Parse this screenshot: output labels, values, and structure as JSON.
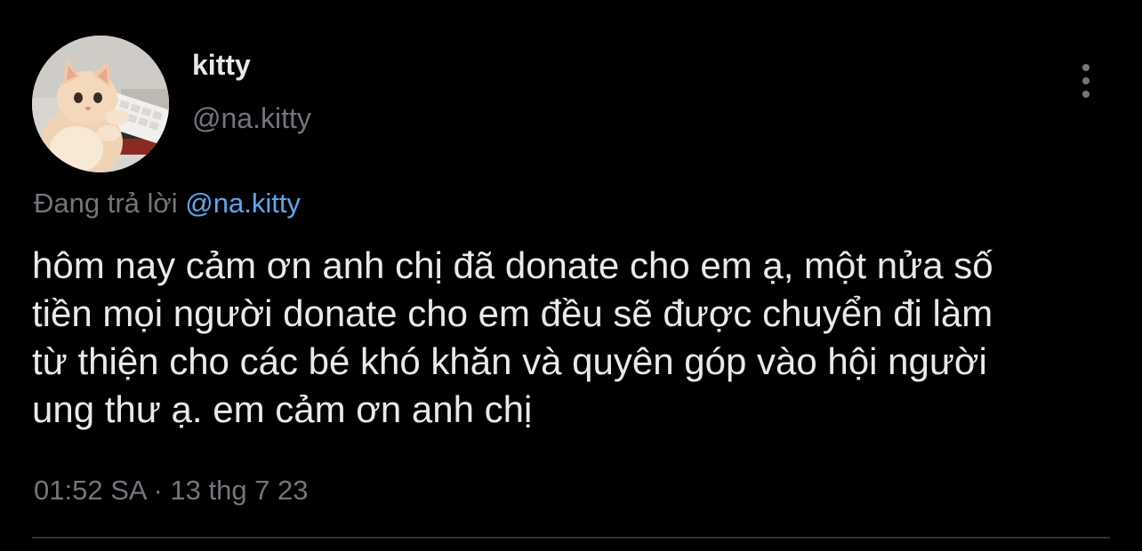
{
  "tweet": {
    "author_name": "kitty",
    "author_handle": "@na.kitty",
    "reply_prefix": "Đang trả lời",
    "reply_to_handle": "@na.kitty",
    "text_lines": [
      "hôm nay cảm ơn anh chị đã donate cho em ạ, một nửa số",
      "tiền mọi người donate cho em đều sẽ được chuyển đi làm",
      "từ thiện cho các bé khó khăn và quyên góp vào hội người",
      "ung thư ạ. em cảm ơn anh chị"
    ],
    "timestamp": "01:52 SA · 13 thg 7 23",
    "avatar_icon": "cat-avatar",
    "more_icon": "more-vertical-icon"
  },
  "colors": {
    "background": "#000000",
    "primary_text": "#e7e9ea",
    "secondary_text": "#71767b",
    "mention": "#5ea7ec",
    "divider": "#2f3336"
  }
}
